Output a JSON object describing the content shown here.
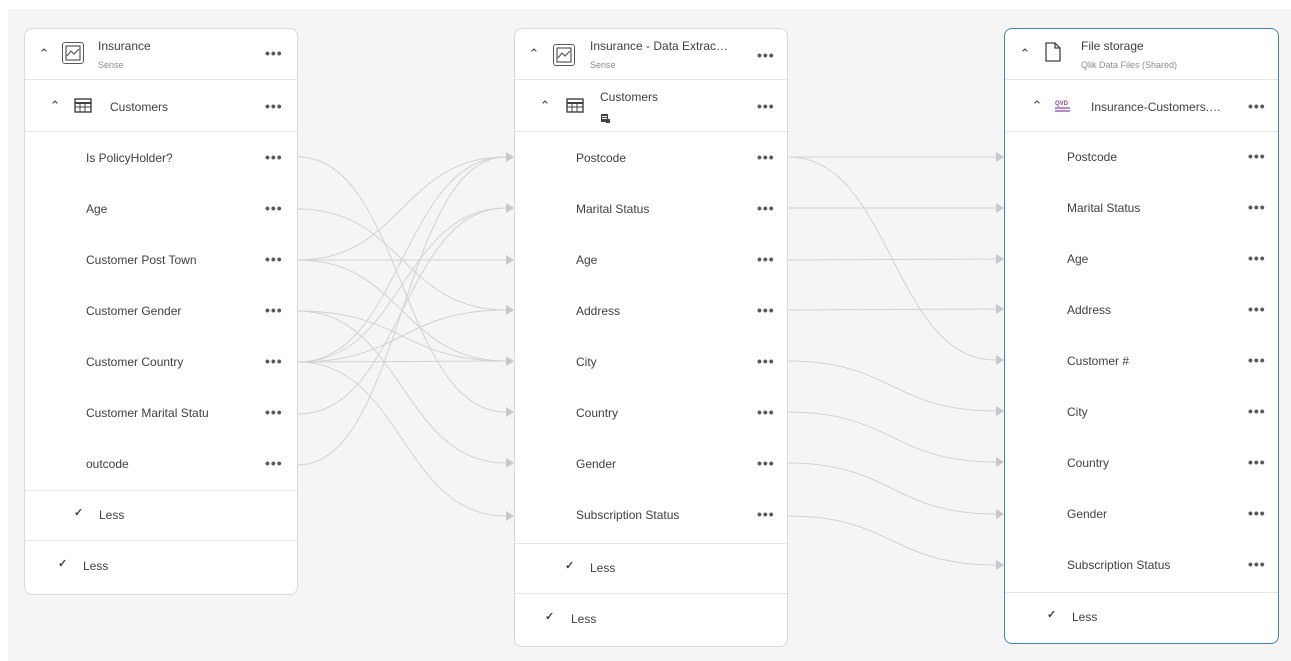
{
  "cards": {
    "insurance": {
      "title": "Insurance",
      "subtitle": "Sense",
      "table": "Customers",
      "fields": [
        "Is PolicyHolder?",
        "Age",
        "Customer Post Town",
        "Customer Gender",
        "Customer Country",
        "Customer Marital Statu",
        "outcode"
      ],
      "less_inner": "Less",
      "less_outer": "Less"
    },
    "extract": {
      "title": "Insurance - Data Extrac…",
      "subtitle": "Sense",
      "table": "Customers",
      "fields": [
        "Postcode",
        "Marital Status",
        "Age",
        "Address",
        "City",
        "Country",
        "Gender",
        "Subscription Status"
      ],
      "less_inner": "Less",
      "less_outer": "Less"
    },
    "storage": {
      "title": "File storage",
      "subtitle": "Qlik Data Files (Shared)",
      "table": "Insurance-Customers.…",
      "fields": [
        "Postcode",
        "Marital Status",
        "Age",
        "Address",
        "Customer #",
        "City",
        "Country",
        "Gender",
        "Subscription Status"
      ],
      "less_inner": "Less"
    }
  },
  "icons": {
    "collapse": "chevron-up-icon",
    "expand": "chevron-down-icon",
    "menu": "more-options-icon",
    "app": "sense-app-icon",
    "table": "table-icon",
    "file": "file-icon",
    "qvd": "qvd-file-icon"
  },
  "menu_glyph": "•••",
  "colors": {
    "accent": "#3f8ab3",
    "line": "#d0d0d0",
    "qvd": "#8e44ad"
  }
}
